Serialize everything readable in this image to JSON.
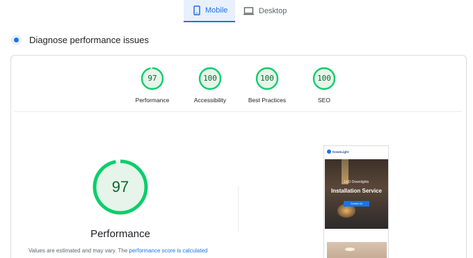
{
  "tabs": [
    {
      "label": "Mobile",
      "icon": "mobile-icon",
      "active": true
    },
    {
      "label": "Desktop",
      "icon": "desktop-icon",
      "active": false
    }
  ],
  "section": {
    "title": "Diagnose performance issues"
  },
  "categories": [
    {
      "label": "Performance",
      "score": "97"
    },
    {
      "label": "Accessibility",
      "score": "100"
    },
    {
      "label": "Best Practices",
      "score": "100"
    },
    {
      "label": "SEO",
      "score": "100"
    }
  ],
  "performance": {
    "score": "97",
    "title": "Performance",
    "note_prefix": "Values are estimated and may vary. The",
    "note_link": "performance score is calculated"
  },
  "screenshot": {
    "brand": "DownLight",
    "subheading": "LED Downlights",
    "heading": "Installation Service",
    "cta": "Contact Us"
  },
  "colors": {
    "accent": "#1a73e8",
    "pass_green": "#0cce6b",
    "pass_fill": "#e6f4ea",
    "pass_text": "#0d652d"
  }
}
